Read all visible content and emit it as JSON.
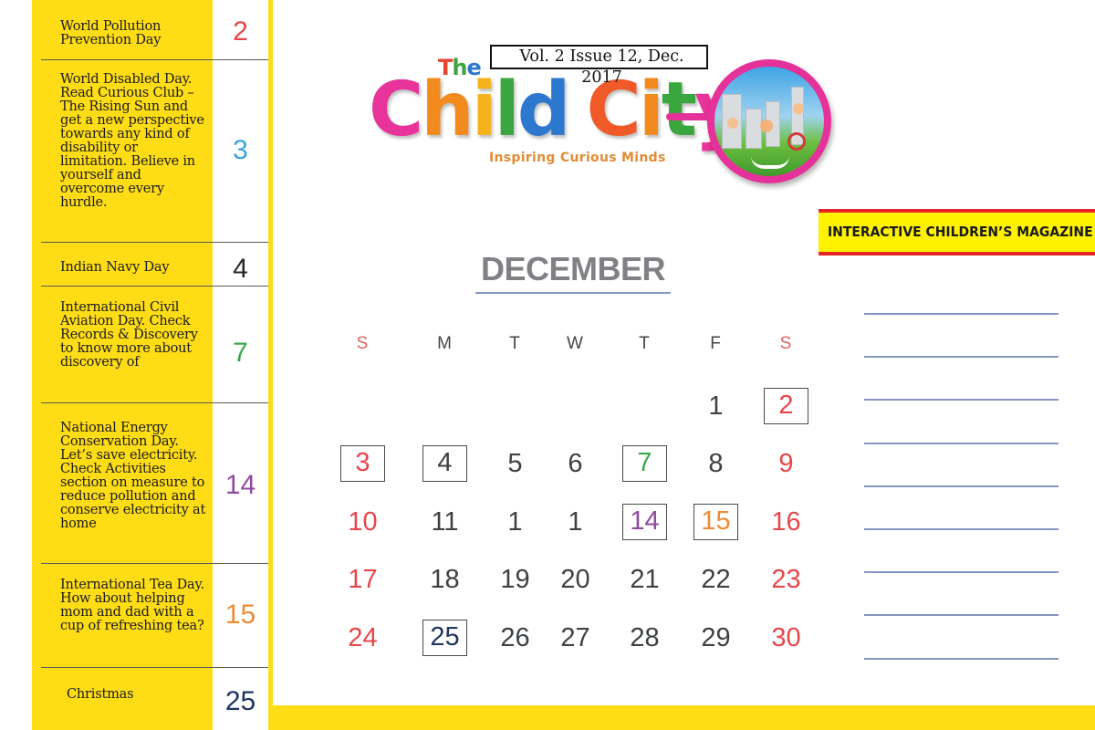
{
  "magazine": {
    "issue": "Vol. 2 Issue 12, Dec. 2017",
    "logo_prefix": "The",
    "logo_name_letters": [
      {
        "ch": "C",
        "color": "#e8339a"
      },
      {
        "ch": "h",
        "color": "#f28a1e"
      },
      {
        "ch": "i",
        "color": "#f6b21b"
      },
      {
        "ch": "l",
        "color": "#3aa63e"
      },
      {
        "ch": "d",
        "color": "#2d78cf"
      },
      {
        "ch": " ",
        "color": "#000000"
      },
      {
        "ch": "C",
        "color": "#ef5a28"
      },
      {
        "ch": "i",
        "color": "#f28a1e"
      },
      {
        "ch": "t",
        "color": "#3aa63e"
      },
      {
        "ch": "y",
        "color": "#e8339a"
      }
    ],
    "logo_prefix_letters": [
      {
        "ch": "T",
        "color": "#e8452f"
      },
      {
        "ch": "h",
        "color": "#3aa63e"
      },
      {
        "ch": "e",
        "color": "#2d78cf"
      }
    ],
    "tagline": "Inspiring Curious Minds",
    "banner": "INTERACTIVE CHILDREN’S MAGAZINE"
  },
  "sidebar": {
    "events": [
      {
        "text": "World Pollution Prevention Day",
        "day": "2",
        "color": "#e5474b"
      },
      {
        "text": "World Disabled Day. Read Curious Club – The Rising Sun and get a new perspective towards any kind of disability or limitation. Believe in yourself and overcome every hurdle.",
        "day": "3",
        "color": "#35a3dc"
      },
      {
        "text": "Indian Navy Day",
        "day": "4",
        "color": "#2d2620"
      },
      {
        "text": "International Civil Aviation Day. Check Records & Discovery to know more about discovery of",
        "day": "7",
        "color": "#3aa64a"
      },
      {
        "text": "National Energy Conservation Day. Let’s save electricity. Check Activities section on measure to reduce pollution and conserve electricity at home",
        "day": "14",
        "color": "#8e4a9c"
      },
      {
        "text": "International Tea Day. How about helping mom and dad with a cup of refreshing tea?",
        "day": "15",
        "color": "#ee8b33"
      },
      {
        "text": "Christmas",
        "day": "25",
        "color": "#1f3560"
      }
    ]
  },
  "calendar": {
    "month": "DECEMBER",
    "weekdays": [
      "S",
      "M",
      "T",
      "W",
      "T",
      "F",
      "S"
    ],
    "weeks": [
      [
        null,
        null,
        null,
        null,
        null,
        {
          "d": "1"
        },
        {
          "d": "2",
          "boxed": true,
          "color": "#e5474b"
        }
      ],
      [
        {
          "d": "3",
          "boxed": true,
          "color": "#e5474b"
        },
        {
          "d": "4",
          "boxed": true
        },
        {
          "d": "5"
        },
        {
          "d": "6"
        },
        {
          "d": "7",
          "boxed": true,
          "color": "#3aa64a"
        },
        {
          "d": "8"
        },
        {
          "d": "9"
        }
      ],
      [
        {
          "d": "10"
        },
        {
          "d": "11"
        },
        {
          "d": "1"
        },
        {
          "d": "1"
        },
        {
          "d": "14",
          "boxed": true,
          "color": "#8e4a9c"
        },
        {
          "d": "15",
          "boxed": true,
          "color": "#ee8b33"
        },
        {
          "d": "16"
        }
      ],
      [
        {
          "d": "17"
        },
        {
          "d": "18"
        },
        {
          "d": "19"
        },
        {
          "d": "20"
        },
        {
          "d": "21"
        },
        {
          "d": "22"
        },
        {
          "d": "23"
        }
      ],
      [
        {
          "d": "24"
        },
        {
          "d": "25",
          "boxed": true,
          "color": "#1f3560"
        },
        {
          "d": "26"
        },
        {
          "d": "27"
        },
        {
          "d": "28"
        },
        {
          "d": "29"
        },
        {
          "d": "30"
        }
      ]
    ]
  },
  "notes": {
    "line_count": 9
  },
  "colors": {
    "yellow": "#fedd17",
    "banner_red": "#e52524",
    "banner_yellow": "#fff200",
    "weekend_red": "#e5474b",
    "line_blue": "#8495bf"
  }
}
